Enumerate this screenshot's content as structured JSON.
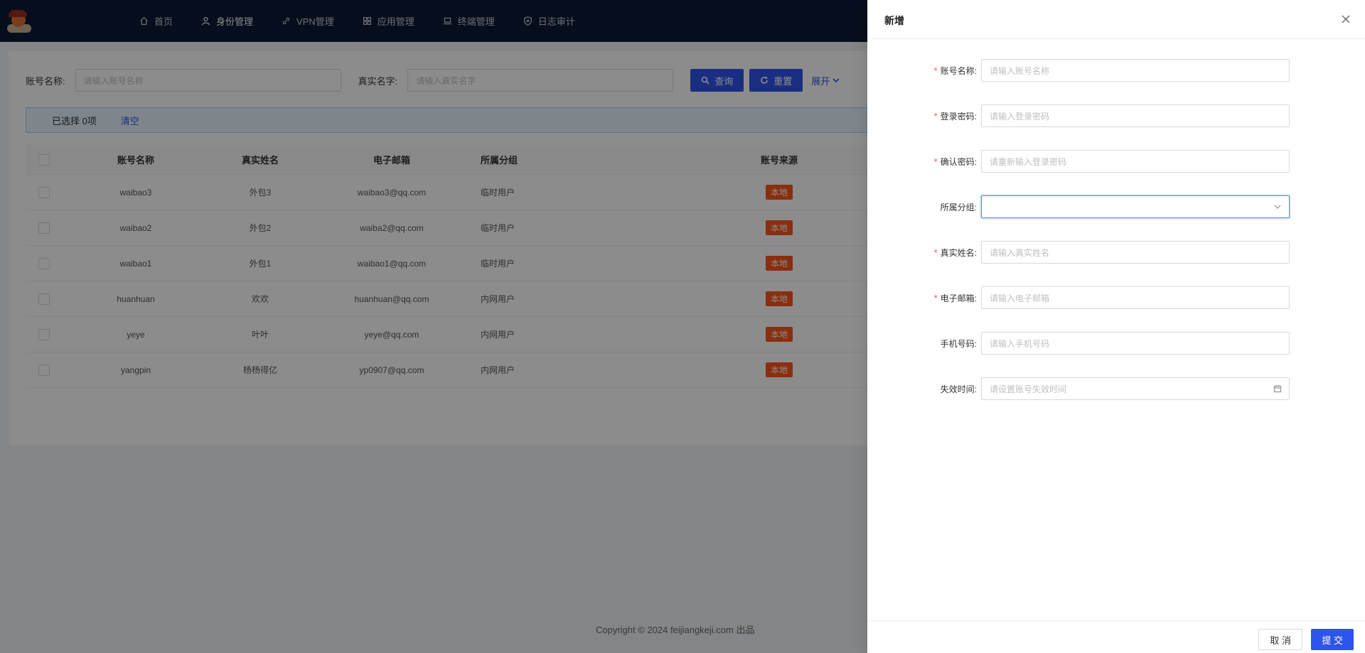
{
  "nav": {
    "items": [
      {
        "label": "首页",
        "icon": "home-icon",
        "active": false
      },
      {
        "label": "身份管理",
        "icon": "user-icon",
        "active": true
      },
      {
        "label": "VPN管理",
        "icon": "link-icon",
        "active": false
      },
      {
        "label": "应用管理",
        "icon": "apps-icon",
        "active": false
      },
      {
        "label": "终端管理",
        "icon": "laptop-icon",
        "active": false
      },
      {
        "label": "日志审计",
        "icon": "shield-icon",
        "active": false
      }
    ]
  },
  "search": {
    "account_label": "账号名称:",
    "account_placeholder": "请输入账号名称",
    "realname_label": "真实名字:",
    "realname_placeholder": "请输入真实名字",
    "query_label": "查询",
    "reset_label": "重置",
    "expand_label": "展开"
  },
  "selection": {
    "text": "已选择 0项",
    "clear_label": "清空"
  },
  "table": {
    "columns": [
      "账号名称",
      "真实姓名",
      "电子邮箱",
      "所属分组",
      "账号来源"
    ],
    "rows": [
      {
        "account": "waibao3",
        "name": "外包3",
        "email": "waibao3@qq.com",
        "group": "临时用户",
        "source": "本地"
      },
      {
        "account": "waibao2",
        "name": "外包2",
        "email": "waiba2@qq.com",
        "group": "临时用户",
        "source": "本地"
      },
      {
        "account": "waibao1",
        "name": "外包1",
        "email": "waibao1@qq.com",
        "group": "临时用户",
        "source": "本地"
      },
      {
        "account": "huanhuan",
        "name": "欢欢",
        "email": "huanhuan@qq.com",
        "group": "内网用户",
        "source": "本地"
      },
      {
        "account": "yeye",
        "name": "叶叶",
        "email": "yeye@qq.com",
        "group": "内网用户",
        "source": "本地"
      },
      {
        "account": "yangpin",
        "name": "杨杨得亿",
        "email": "yp0907@qq.com",
        "group": "内网用户",
        "source": "本地"
      }
    ]
  },
  "footer": {
    "copyright": "Copyright © 2024 feijiangkeji.com 出品"
  },
  "drawer": {
    "title": "新增",
    "fields": [
      {
        "label": "账号名称:",
        "required": true,
        "placeholder": "请输入账号名称",
        "type": "text"
      },
      {
        "label": "登录密码:",
        "required": true,
        "placeholder": "请输入登录密码",
        "type": "text"
      },
      {
        "label": "确认密码:",
        "required": true,
        "placeholder": "请重新输入登录密码",
        "type": "text"
      },
      {
        "label": "所属分组:",
        "required": false,
        "placeholder": "",
        "type": "select"
      },
      {
        "label": "真实姓名:",
        "required": true,
        "placeholder": "请输入真实姓名",
        "type": "text"
      },
      {
        "label": "电子邮箱:",
        "required": true,
        "placeholder": "请输入电子邮箱",
        "type": "text"
      },
      {
        "label": "手机号码:",
        "required": false,
        "placeholder": "请输入手机号码",
        "type": "text"
      },
      {
        "label": "失效时间:",
        "required": false,
        "placeholder": "请设置账号失效时间",
        "type": "date"
      }
    ],
    "cancel_label": "取 消",
    "submit_label": "提 交"
  },
  "colors": {
    "primary": "#2f54eb",
    "nav_bg": "#0a1a33",
    "tag": "#fa541c",
    "required": "#ff4d4f"
  }
}
